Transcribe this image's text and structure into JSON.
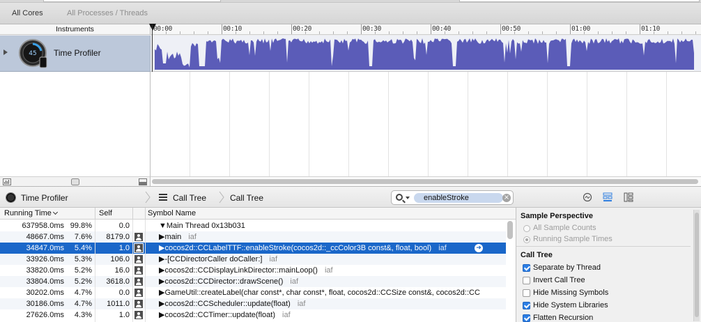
{
  "scope_bar": {
    "all_cores": "All Cores",
    "all_processes": "All Processes / Threads"
  },
  "instruments": {
    "header": "Instruments",
    "timeline_ticks": [
      "00:00",
      "00:10",
      "00:20",
      "00:30",
      "00:40",
      "00:50",
      "01:00",
      "01:10"
    ],
    "instrument_name": "Time Profiler",
    "icon_readout": "45"
  },
  "jump_bar": {
    "crumb1": "Time Profiler",
    "crumb2": "Call Tree",
    "crumb3": "Call Tree",
    "search_token": "enableStroke"
  },
  "table": {
    "columns": {
      "running_time": "Running Time",
      "self": "Self",
      "symbol_name": "Symbol Name"
    },
    "rows": [
      {
        "time": "637958.0ms",
        "pct": "99.8%",
        "self": "0.0",
        "symbol": "▼Main Thread  0x13b031",
        "lib": "",
        "avatar": false,
        "selected": false
      },
      {
        "time": "48667.0ms",
        "pct": "7.6%",
        "self": "8179.0",
        "symbol": "▶main",
        "lib": "iaf",
        "avatar": true,
        "selected": false
      },
      {
        "time": "34847.0ms",
        "pct": "5.4%",
        "self": "1.0",
        "symbol": "▶cocos2d::CCLabelTTF::enableStroke(cocos2d::_ccColor3B const&, float, bool)",
        "lib": "iaf",
        "avatar": true,
        "selected": true
      },
      {
        "time": "33926.0ms",
        "pct": "5.3%",
        "self": "106.0",
        "symbol": "▶-[CCDirectorCaller doCaller:]",
        "lib": "iaf",
        "avatar": true,
        "selected": false
      },
      {
        "time": "33820.0ms",
        "pct": "5.2%",
        "self": "16.0",
        "symbol": "▶cocos2d::CCDisplayLinkDirector::mainLoop()",
        "lib": "iaf",
        "avatar": true,
        "selected": false
      },
      {
        "time": "33804.0ms",
        "pct": "5.2%",
        "self": "3618.0",
        "symbol": "▶cocos2d::CCDirector::drawScene()",
        "lib": "iaf",
        "avatar": true,
        "selected": false
      },
      {
        "time": "30202.0ms",
        "pct": "4.7%",
        "self": "0.0",
        "symbol": "▶GameUtil::createLabel(char const*, char const*, float, cocos2d::CCSize const&, cocos2d::CC",
        "lib": "",
        "avatar": true,
        "selected": false
      },
      {
        "time": "30186.0ms",
        "pct": "4.7%",
        "self": "1011.0",
        "symbol": "▶cocos2d::CCScheduler::update(float)",
        "lib": "iaf",
        "avatar": true,
        "selected": false
      },
      {
        "time": "27626.0ms",
        "pct": "4.3%",
        "self": "1.0",
        "symbol": "▶cocos2d::CCTimer::update(float)",
        "lib": "iaf",
        "avatar": true,
        "selected": false
      }
    ]
  },
  "inspector": {
    "sample_perspective": "Sample Perspective",
    "all_sample_counts": "All Sample Counts",
    "running_sample_times": "Running Sample Times",
    "call_tree": "Call Tree",
    "options": [
      {
        "label": "Separate by Thread",
        "checked": true
      },
      {
        "label": "Invert Call Tree",
        "checked": false
      },
      {
        "label": "Hide Missing Symbols",
        "checked": false
      },
      {
        "label": "Hide System Libraries",
        "checked": true
      },
      {
        "label": "Flatten Recursion",
        "checked": true
      }
    ]
  },
  "colors": {
    "track_fill": "#5b5cb8",
    "selection": "#1a67c9",
    "instrument_row": "#bcc8da"
  }
}
